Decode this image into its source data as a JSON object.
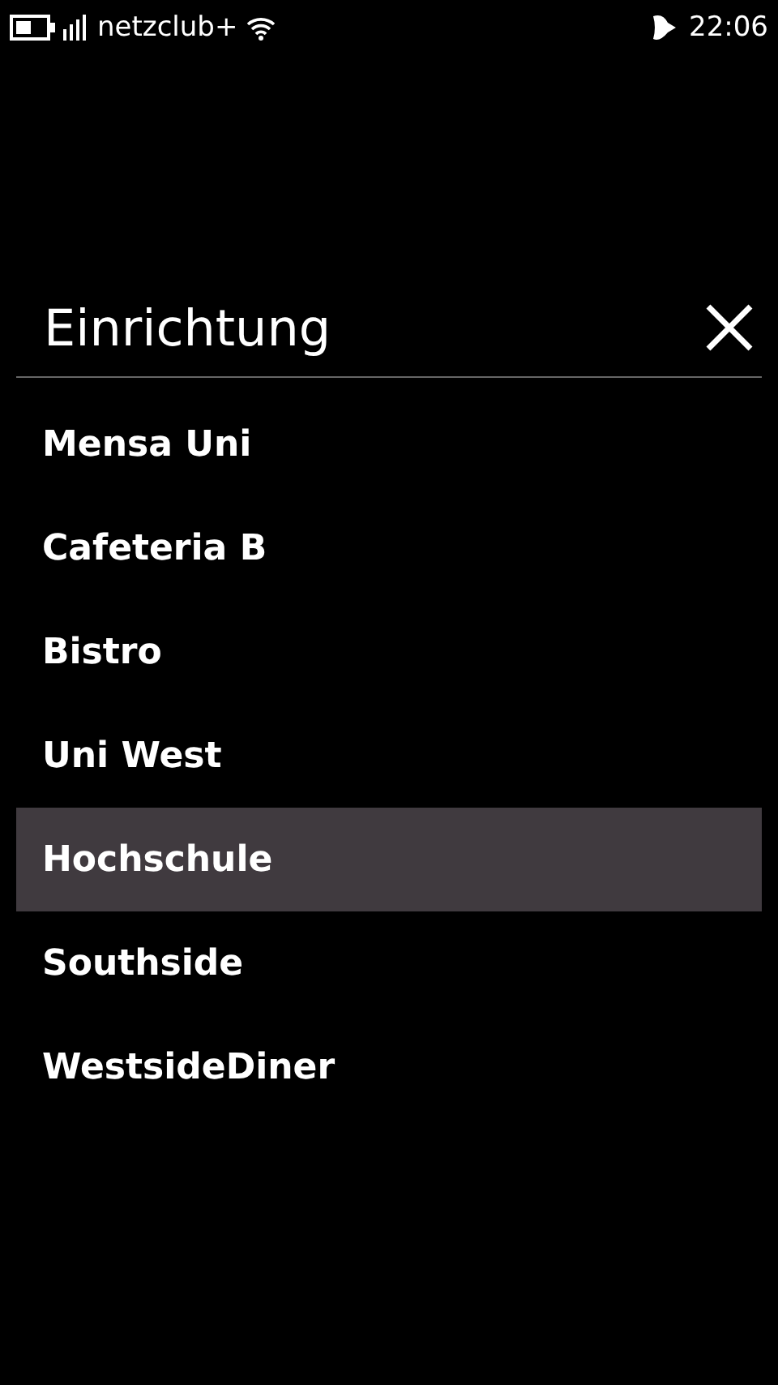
{
  "status_bar": {
    "carrier": "netzclub+",
    "time": "22:06"
  },
  "dialog": {
    "title": "Einrichtung",
    "items": [
      {
        "label": "Mensa Uni",
        "selected": false
      },
      {
        "label": "Cafeteria B",
        "selected": false
      },
      {
        "label": "Bistro",
        "selected": false
      },
      {
        "label": "Uni West",
        "selected": false
      },
      {
        "label": "Hochschule",
        "selected": true
      },
      {
        "label": "Southside",
        "selected": false
      },
      {
        "label": "WestsideDiner",
        "selected": false
      }
    ]
  }
}
